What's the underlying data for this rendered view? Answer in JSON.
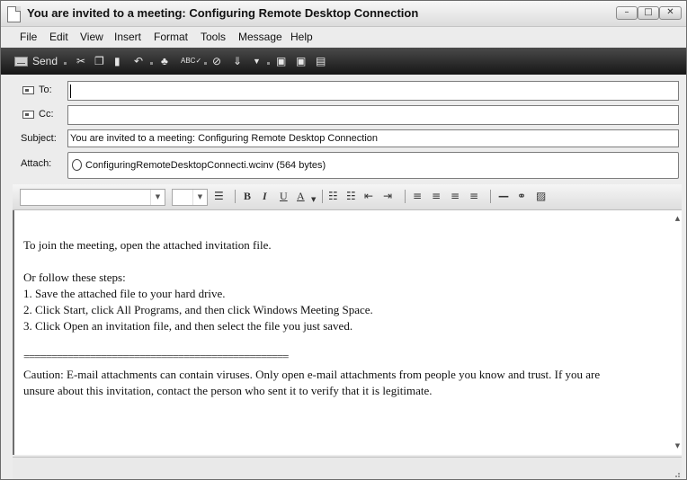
{
  "window": {
    "title": "You are invited to a meeting: Configuring Remote Desktop Connection",
    "min": "–",
    "max": "□",
    "close": "✕"
  },
  "menu": [
    "File",
    "Edit",
    "View",
    "Insert",
    "Format",
    "Tools",
    "Message",
    "Help"
  ],
  "toolbar": {
    "send": "Send",
    "icons": [
      "cut-icon",
      "copy-icon",
      "paste-icon",
      "undo-icon",
      "check-names-icon",
      "spelling-icon",
      "attach-icon",
      "priority-icon",
      "priority-dropdown-icon",
      "sign-icon",
      "encrypt-icon",
      "work-offline-icon"
    ]
  },
  "header": {
    "to_label": "To:",
    "to_value": "",
    "cc_label": "Cc:",
    "cc_value": "",
    "subject_label": "Subject:",
    "subject_value": "You are invited to a meeting: Configuring Remote Desktop Connection",
    "attach_label": "Attach:",
    "attachment": "ConfiguringRemoteDesktopConnecti.wcinv (564 bytes)"
  },
  "format": {
    "font": "",
    "size": "",
    "buttons": [
      "B",
      "I",
      "U",
      "A"
    ]
  },
  "body": {
    "lines": [
      "To join the meeting, open the attached invitation file.",
      "Or follow these steps:",
      "1. Save the attached file to your hard drive.",
      "2. Click Start, click All Programs, and then click Windows Meeting Space.",
      "3. Click Open an invitation file, and then select the file you just saved.",
      "================================================",
      "Caution: E-mail attachments can contain viruses. Only open e-mail attachments from people you know and trust. If you are",
      "unsure about this invitation, contact the person who sent it to verify that it is legitimate."
    ]
  }
}
